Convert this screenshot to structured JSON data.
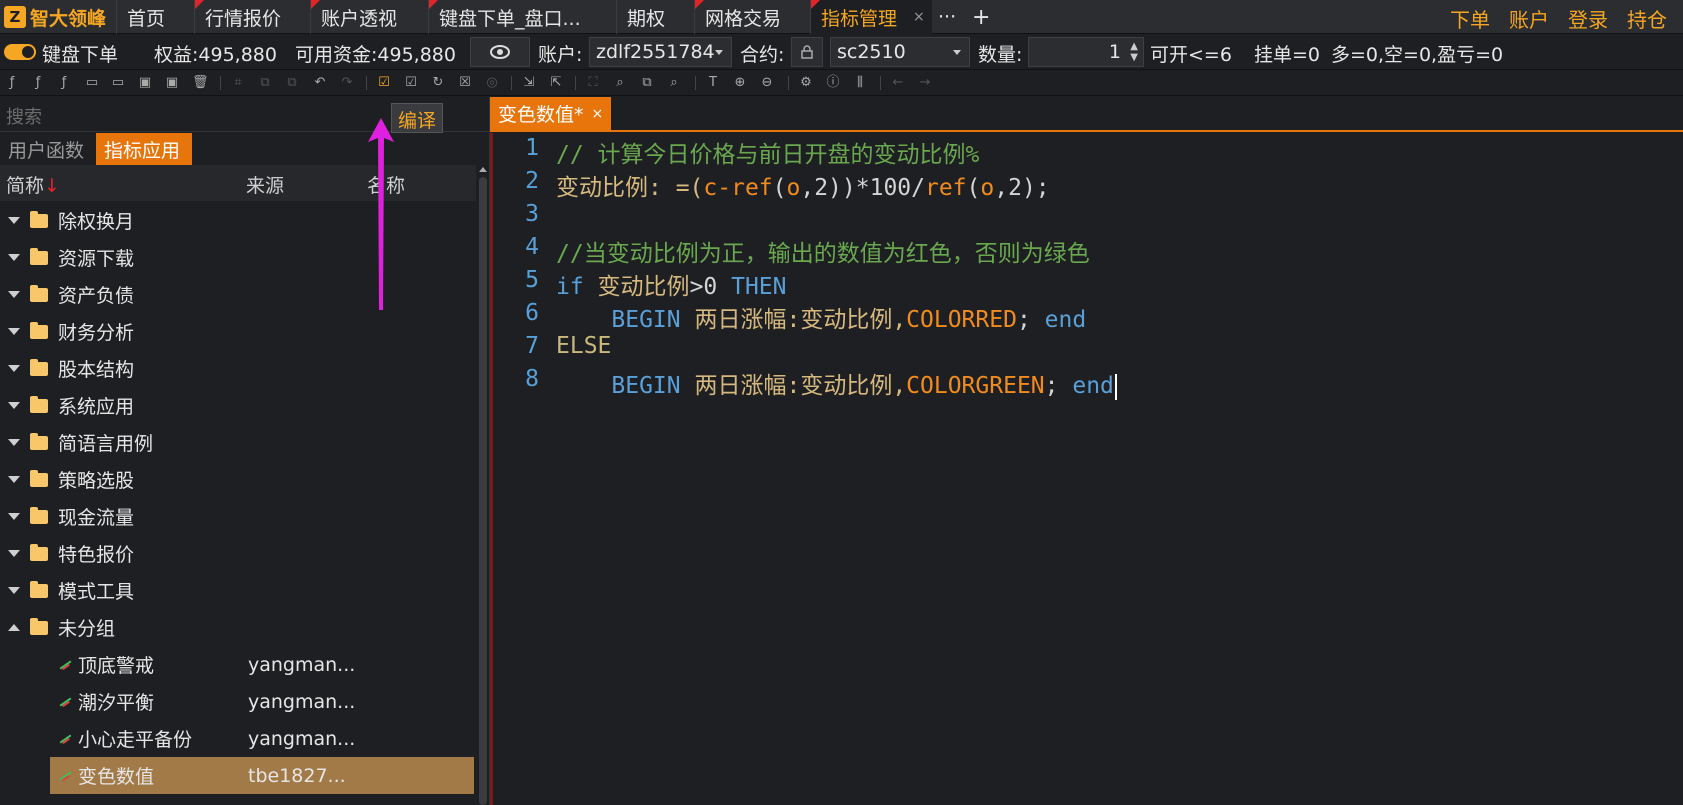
{
  "app": {
    "logo_text": "智大领峰",
    "logo_mark": "Z"
  },
  "top_tabs": [
    {
      "label": "首页"
    },
    {
      "label": "行情报价"
    },
    {
      "label": "账户透视"
    },
    {
      "label": "键盘下单_盘口..."
    },
    {
      "label": "期权"
    },
    {
      "label": "网格交易"
    },
    {
      "label": "指标管理",
      "active": true
    }
  ],
  "top_tabs_more": "···",
  "top_tabs_add": "+",
  "top_right": [
    "下单",
    "账户",
    "登录",
    "持仓"
  ],
  "info": {
    "mode_label": "键盘下单",
    "equity": "权益:495,880",
    "available": "可用资金:495,880",
    "account_label": "账户:",
    "account_value": "zdlf2551784",
    "contract_label": "合约:",
    "contract_value": "sc2510",
    "qty_label": "数量:",
    "qty_value": "1",
    "can_open": "可开<=6",
    "pending": "挂单=0",
    "position": "多=0,空=0,盈亏=0"
  },
  "tooltip": "编译",
  "left": {
    "search_placeholder": "搜索",
    "tabs": [
      "用户函数",
      "指标应用"
    ],
    "columns": {
      "short": "简称",
      "sort_arrow": "↓",
      "source": "来源",
      "name": "名称"
    },
    "folders": [
      "除权换月",
      "资源下载",
      "资产负债",
      "财务分析",
      "股本结构",
      "系统应用",
      "简语言用例",
      "策略选股",
      "现金流量",
      "特色报价",
      "模式工具",
      "未分组"
    ],
    "items": [
      {
        "label": "顶底警戒",
        "source": "yangman..."
      },
      {
        "label": "潮汐平衡",
        "source": "yangman..."
      },
      {
        "label": "小心走平备份",
        "source": "yangman..."
      },
      {
        "label": "变色数值",
        "source": "tbe1827...",
        "selected": true
      }
    ]
  },
  "editor": {
    "tab_label": "变色数值*",
    "tab_close": "×",
    "line_numbers": [
      "1",
      "2",
      "3",
      "4",
      "5",
      "6",
      "7",
      "8"
    ],
    "lines": {
      "l1": "// 计算今日价格与前日开盘的变动比例%",
      "l2_a": "变动比例: =(",
      "l2_b": "c-",
      "l2_c": "ref",
      "l2_d": "(",
      "l2_e": "o",
      "l2_f": ",2))*100/",
      "l2_g": "ref",
      "l2_h": "(",
      "l2_i": "o",
      "l2_j": ",2);",
      "l4": "//当变动比例为正，输出的数值为红色，否则为绿色",
      "l5_a": "if",
      "l5_b": " 变动比例",
      "l5_c": ">0 ",
      "l5_d": "THEN",
      "l6_a": "    BEGIN",
      "l6_b": " 两日涨幅:变动比例,",
      "l6_c": "COLORRED",
      "l6_d": "; ",
      "l6_e": "end",
      "l7": "ELSE",
      "l8_a": "    BEGIN",
      "l8_b": " 两日涨幅:变动比例,",
      "l8_c": "COLORGREEN",
      "l8_d": "; ",
      "l8_e": "end"
    }
  },
  "colors": {
    "accent": "#f5a623",
    "tab_active": "#e8740c",
    "selected_row": "#a27a47",
    "arrow": "#e020e0"
  }
}
